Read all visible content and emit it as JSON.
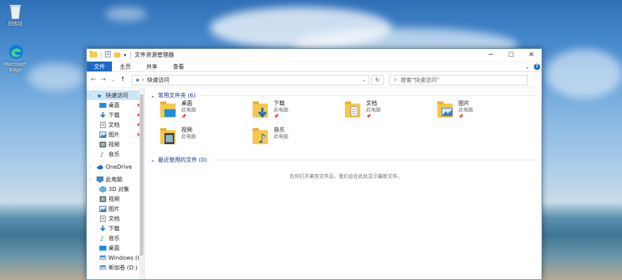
{
  "desktop": {
    "icons": [
      {
        "label": "回收站",
        "icon": "recycle-bin-icon"
      },
      {
        "label": "Microsoft Edge",
        "icon": "edge-icon"
      }
    ]
  },
  "window": {
    "title": "文件资源管理器",
    "quick_access_toolbar": [
      "properties-icon",
      "new-folder-icon",
      "dropdown-icon"
    ],
    "ribbon_tabs": [
      "文件",
      "主页",
      "共享",
      "查看"
    ],
    "address": "快速访问",
    "search_placeholder": "搜索\"快速访问\"",
    "accent": "#1b6ac9"
  },
  "nav": {
    "items": [
      {
        "label": "快速访问",
        "icon": "star-icon",
        "level": 1,
        "selected": true
      },
      {
        "label": "桌面",
        "icon": "desktop-icon",
        "level": 2,
        "pinned": true
      },
      {
        "label": "下载",
        "icon": "download-icon",
        "level": 2,
        "pinned": true
      },
      {
        "label": "文档",
        "icon": "document-icon",
        "level": 2,
        "pinned": true
      },
      {
        "label": "图片",
        "icon": "picture-icon",
        "level": 2,
        "pinned": true
      },
      {
        "label": "视频",
        "icon": "video-icon",
        "level": 2
      },
      {
        "label": "音乐",
        "icon": "music-icon",
        "level": 2
      },
      {
        "label": "OneDrive",
        "icon": "cloud-icon",
        "level": 1
      },
      {
        "label": "此电脑",
        "icon": "computer-icon",
        "level": 1
      },
      {
        "label": "3D 对象",
        "icon": "cube-icon",
        "level": 2
      },
      {
        "label": "视频",
        "icon": "video-icon",
        "level": 2
      },
      {
        "label": "图片",
        "icon": "picture-icon",
        "level": 2
      },
      {
        "label": "文档",
        "icon": "document-icon",
        "level": 2
      },
      {
        "label": "下载",
        "icon": "download-icon",
        "level": 2
      },
      {
        "label": "音乐",
        "icon": "music-icon",
        "level": 2
      },
      {
        "label": "桌面",
        "icon": "desktop-icon",
        "level": 2
      },
      {
        "label": "Windows (C:)",
        "icon": "drive-icon",
        "level": 2
      },
      {
        "label": "新加卷 (D:)",
        "icon": "drive-icon",
        "level": 2
      }
    ]
  },
  "content": {
    "frequent_header": "常用文件夹 (6)",
    "frequent": [
      {
        "name": "桌面",
        "location": "此电脑",
        "pinned": true,
        "overlay": "desktop"
      },
      {
        "name": "下载",
        "location": "此电脑",
        "pinned": true,
        "overlay": "download"
      },
      {
        "name": "文档",
        "location": "此电脑",
        "pinned": true,
        "overlay": "document"
      },
      {
        "name": "图片",
        "location": "此电脑",
        "pinned": true,
        "overlay": "picture"
      },
      {
        "name": "视频",
        "location": "此电脑",
        "pinned": false,
        "overlay": "video"
      },
      {
        "name": "音乐",
        "location": "此电脑",
        "pinned": false,
        "overlay": "music"
      }
    ],
    "recent_header": "最近使用的文件 (0)",
    "recent_empty": "在你打开某些文件后，我们会在此处显示最新文件。"
  }
}
